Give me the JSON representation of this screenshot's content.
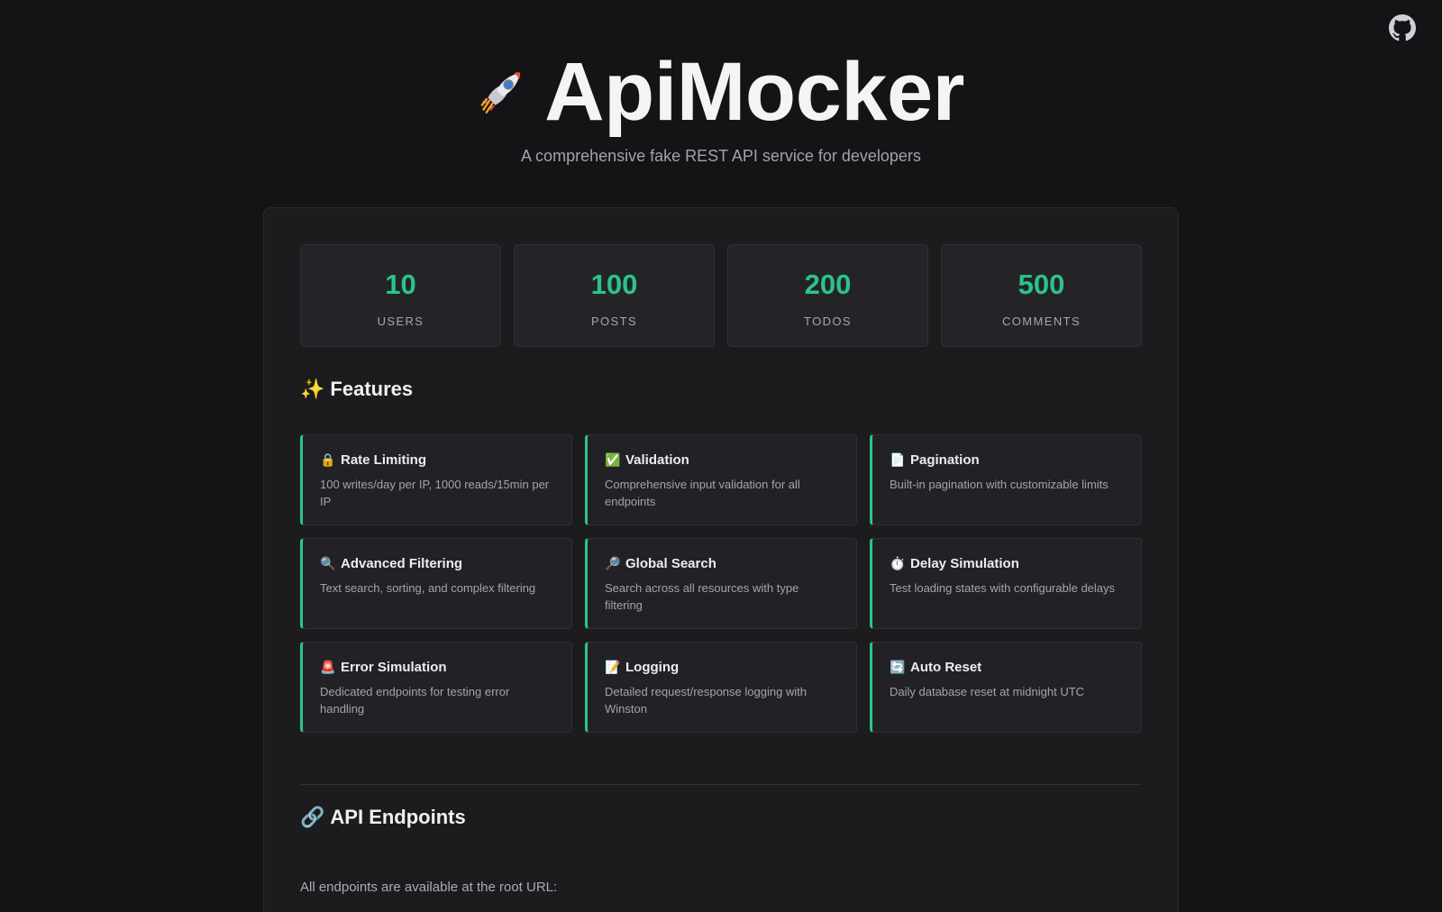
{
  "header": {
    "title": "ApiMocker",
    "subtitle": "A comprehensive fake REST API service for developers",
    "icon": "rocket-icon"
  },
  "github": {
    "icon": "github-icon"
  },
  "colors": {
    "accent": "#2bc48a",
    "background": "#141416",
    "card": "#1c1c1f"
  },
  "stats": [
    {
      "value": "10",
      "label": "USERS"
    },
    {
      "value": "100",
      "label": "POSTS"
    },
    {
      "value": "200",
      "label": "TODOS"
    },
    {
      "value": "500",
      "label": "COMMENTS"
    }
  ],
  "features_section": {
    "emoji": "✨",
    "title": "Features",
    "items": [
      {
        "emoji": "🔒",
        "title": "Rate Limiting",
        "desc": "100 writes/day per IP, 1000 reads/15min per IP"
      },
      {
        "emoji": "✅",
        "title": "Validation",
        "desc": "Comprehensive input validation for all endpoints"
      },
      {
        "emoji": "📄",
        "title": "Pagination",
        "desc": "Built-in pagination with customizable limits"
      },
      {
        "emoji": "🔍",
        "title": "Advanced Filtering",
        "desc": "Text search, sorting, and complex filtering"
      },
      {
        "emoji": "🔎",
        "title": "Global Search",
        "desc": "Search across all resources with type filtering"
      },
      {
        "emoji": "⏱️",
        "title": "Delay Simulation",
        "desc": "Test loading states with configurable delays"
      },
      {
        "emoji": "🚨",
        "title": "Error Simulation",
        "desc": "Dedicated endpoints for testing error handling"
      },
      {
        "emoji": "📝",
        "title": "Logging",
        "desc": "Detailed request/response logging with Winston"
      },
      {
        "emoji": "🔄",
        "title": "Auto Reset",
        "desc": "Daily database reset at midnight UTC"
      }
    ]
  },
  "endpoints_section": {
    "emoji": "🔗",
    "title": "API Endpoints",
    "intro": "All endpoints are available at the root URL:"
  }
}
